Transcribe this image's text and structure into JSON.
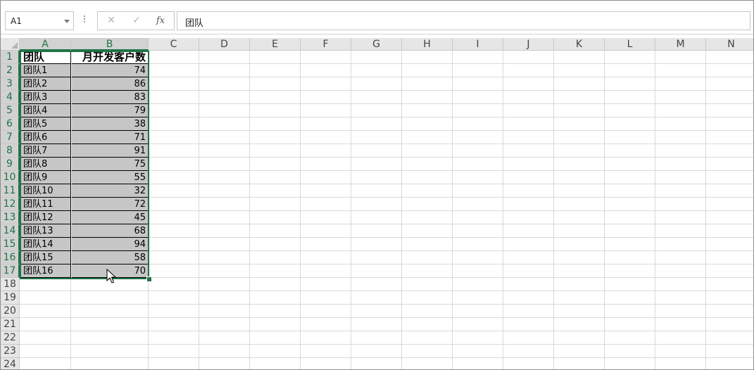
{
  "formula_bar": {
    "name_box": "A1",
    "cancel_icon": "close-icon",
    "enter_icon": "check-icon",
    "fx_label": "fx",
    "content": "团队"
  },
  "columns": [
    "A",
    "B",
    "C",
    "D",
    "E",
    "F",
    "G",
    "H",
    "I",
    "J",
    "K",
    "L",
    "M",
    "N"
  ],
  "selected_columns": [
    "A",
    "B"
  ],
  "rows": [
    "1",
    "2",
    "3",
    "4",
    "5",
    "6",
    "7",
    "8",
    "9",
    "10",
    "11",
    "12",
    "13",
    "14",
    "15",
    "16",
    "17",
    "18",
    "19",
    "20",
    "21",
    "22",
    "23",
    "24"
  ],
  "table": {
    "header": {
      "team": "团队",
      "customers": "月开发客户数"
    },
    "data": [
      {
        "team": "团队1",
        "value": "74"
      },
      {
        "team": "团队2",
        "value": "86"
      },
      {
        "team": "团队3",
        "value": "83"
      },
      {
        "team": "团队4",
        "value": "79"
      },
      {
        "team": "团队5",
        "value": "38"
      },
      {
        "team": "团队6",
        "value": "71"
      },
      {
        "team": "团队7",
        "value": "91"
      },
      {
        "team": "团队8",
        "value": "75"
      },
      {
        "team": "团队9",
        "value": "55"
      },
      {
        "team": "团队10",
        "value": "32"
      },
      {
        "team": "团队11",
        "value": "72"
      },
      {
        "team": "团队12",
        "value": "45"
      },
      {
        "team": "团队13",
        "value": "68"
      },
      {
        "team": "团队14",
        "value": "94"
      },
      {
        "team": "团队15",
        "value": "58"
      },
      {
        "team": "团队16",
        "value": "70"
      }
    ]
  },
  "colors": {
    "selection": "#217346",
    "selected_fill": "#c6c6c6",
    "header_fill": "#e6e6e6"
  }
}
